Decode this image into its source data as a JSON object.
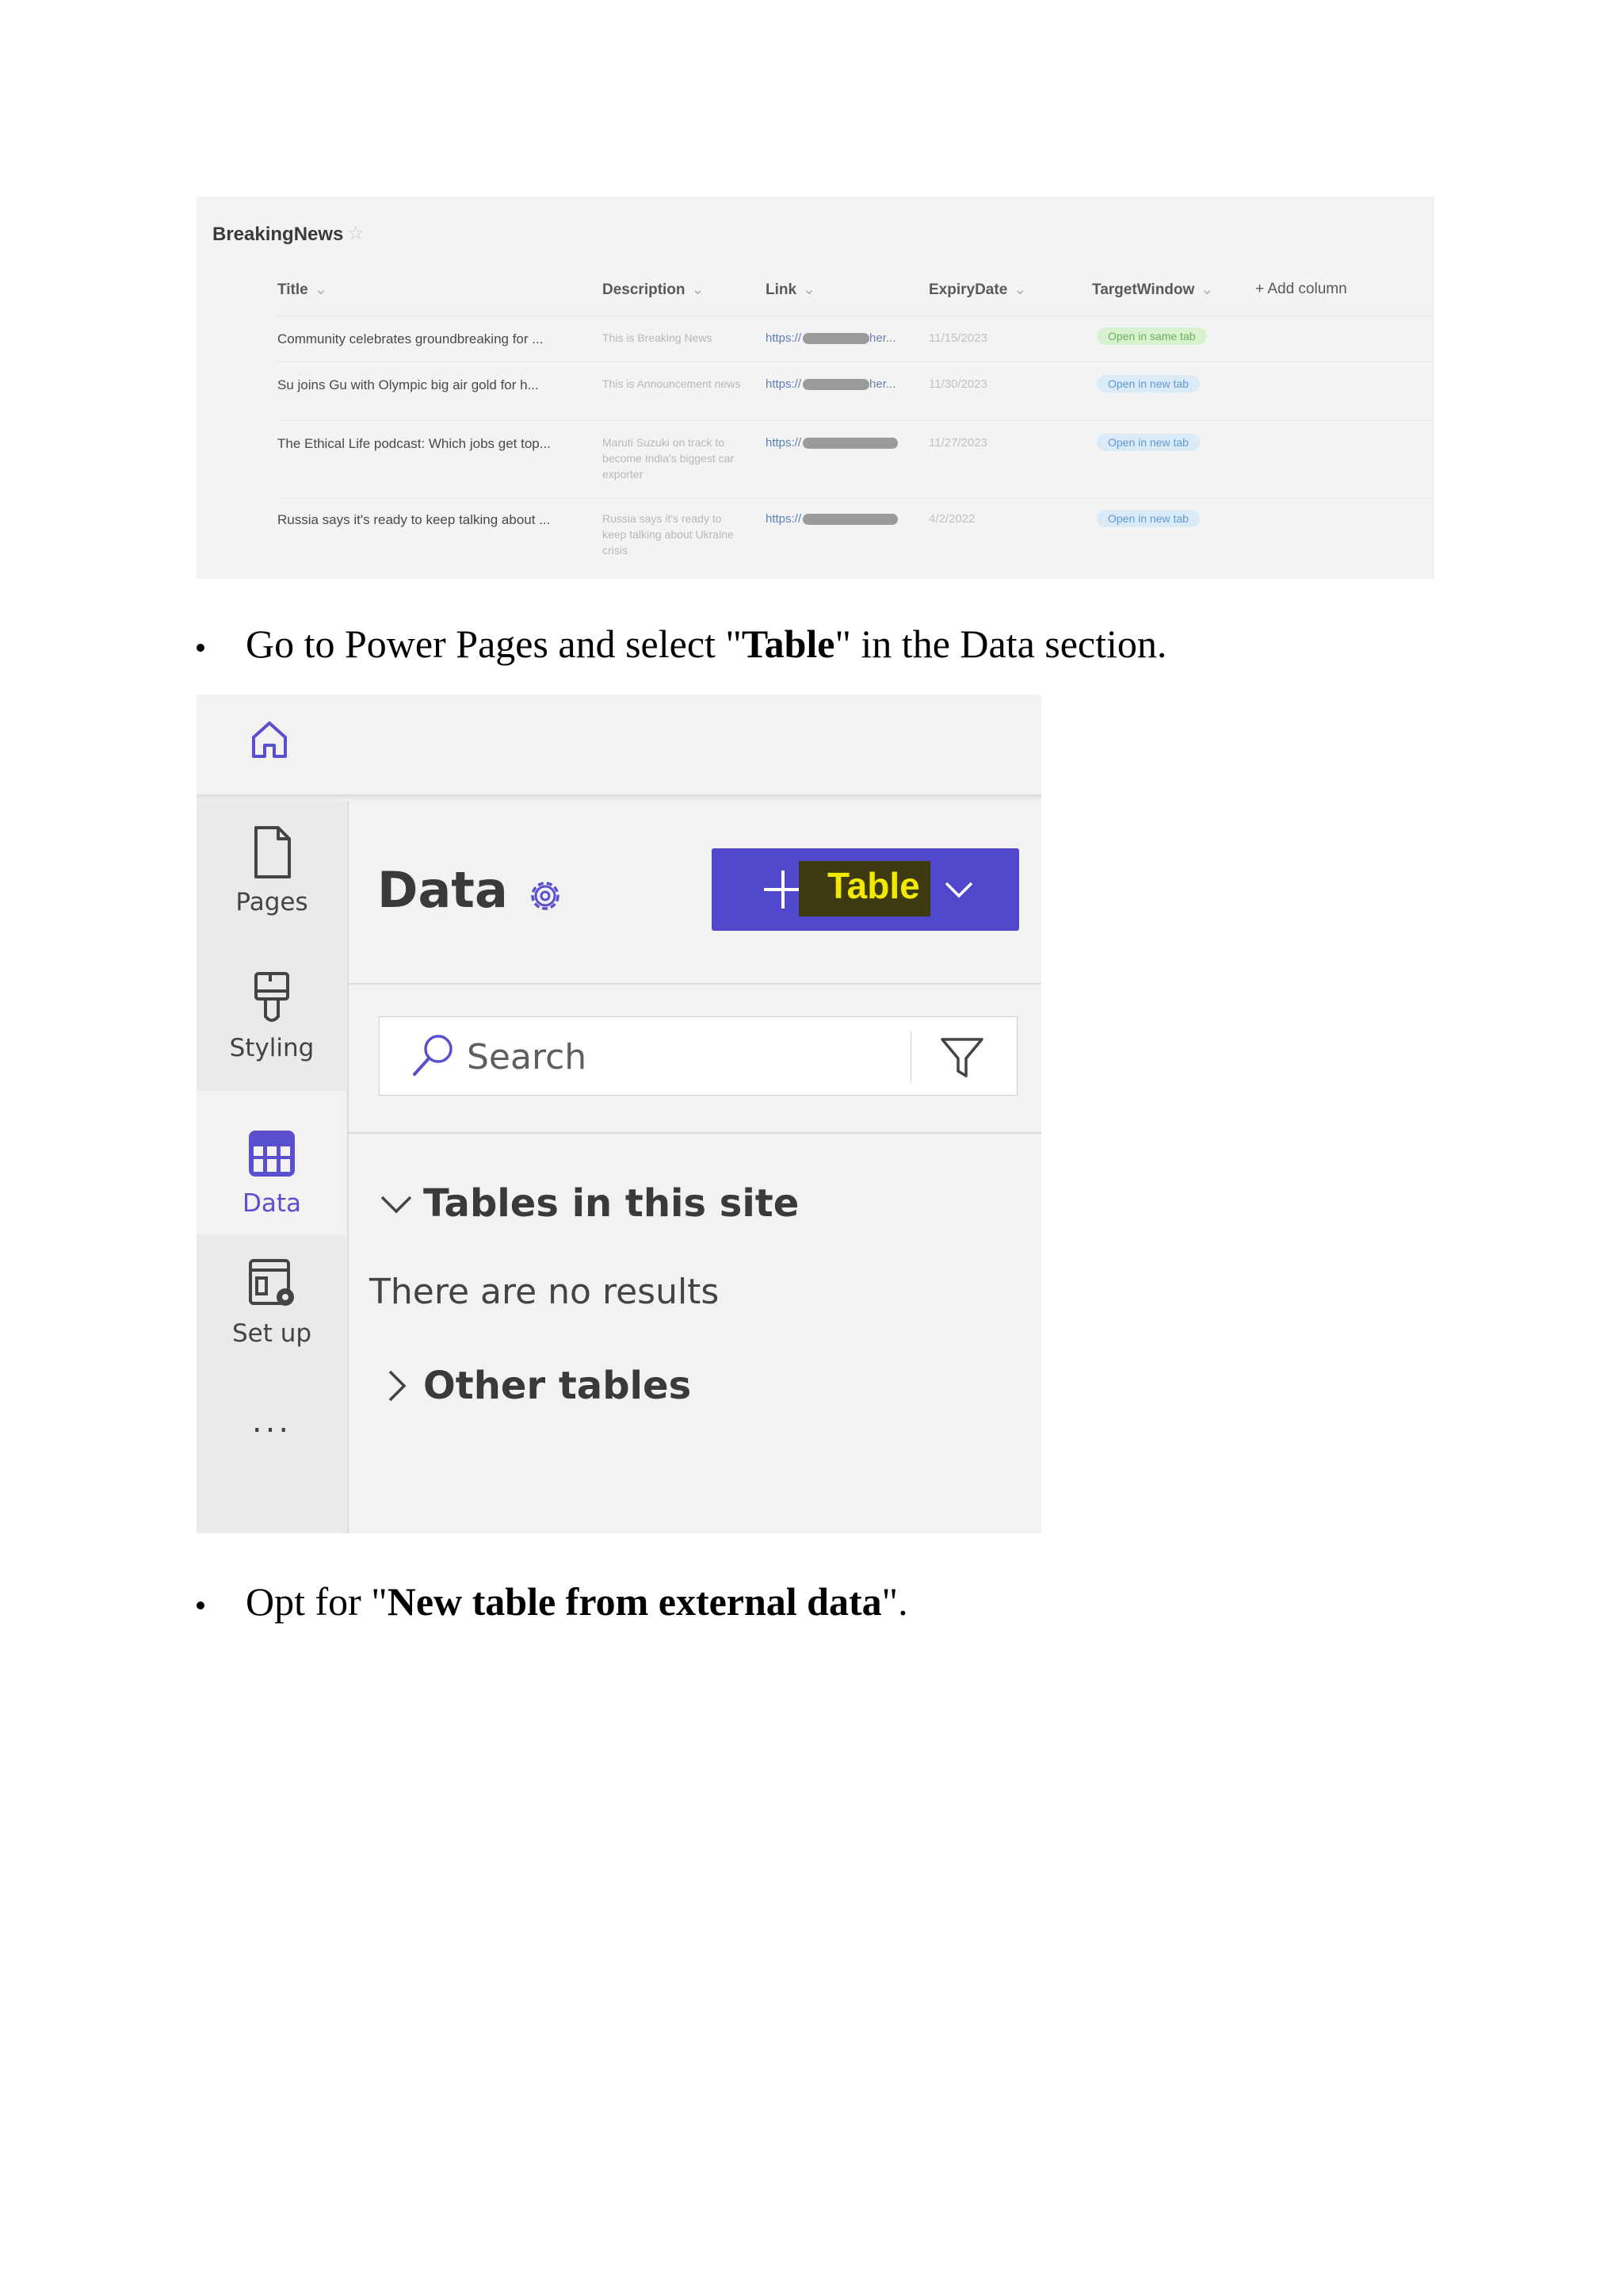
{
  "list_screenshot": {
    "title": "BreakingNews",
    "columns": [
      "Title",
      "Description",
      "Link",
      "ExpiryDate",
      "TargetWindow"
    ],
    "add_column": "+ Add column",
    "rows": [
      {
        "title": "Community celebrates groundbreaking for ...",
        "description": "This is Breaking News",
        "link": "https://",
        "link_tail": "her...",
        "expiry": "11/15/2023",
        "target": "Open in same tab"
      },
      {
        "title": "Su joins Gu with Olympic big air gold for h...",
        "description": "This is Announcement news",
        "link": "https://",
        "link_tail": "her...",
        "expiry": "11/30/2023",
        "target": "Open in new tab"
      },
      {
        "title": "The Ethical Life podcast: Which jobs get top...",
        "description": "Maruti Suzuki on track to become India's biggest car exporter",
        "link": "https://",
        "link_tail": "",
        "expiry": "11/27/2023",
        "target": "Open in new tab"
      },
      {
        "title": "Russia says it's ready to keep talking about ...",
        "description": "Russia says it's ready to keep talking about Ukraine crisis",
        "link": "https://",
        "link_tail": "",
        "expiry": "4/2/2022",
        "target": "Open in new tab"
      }
    ]
  },
  "instructions": {
    "step1_pre": "Go to Power Pages and select \"",
    "step1_bold": "Table",
    "step1_post": "\" in the Data section.",
    "step2_pre": "Opt for \"",
    "step2_bold": "New table from external data",
    "step2_post": "\"."
  },
  "power_pages": {
    "nav": {
      "home": "home-icon",
      "items": [
        {
          "label": "Pages",
          "icon": "page-icon"
        },
        {
          "label": "Styling",
          "icon": "paintbrush-icon"
        },
        {
          "label": "Data",
          "icon": "table-icon",
          "active": true
        },
        {
          "label": "Set up",
          "icon": "setup-icon"
        }
      ],
      "more": "..."
    },
    "heading": "Data",
    "add_button_label": "Table",
    "search_placeholder": "Search",
    "section_site": "Tables in this site",
    "no_results": "There are no results",
    "section_other": "Other tables",
    "colors": {
      "accent": "#5047cd",
      "highlight_text": "#f2e900"
    }
  }
}
